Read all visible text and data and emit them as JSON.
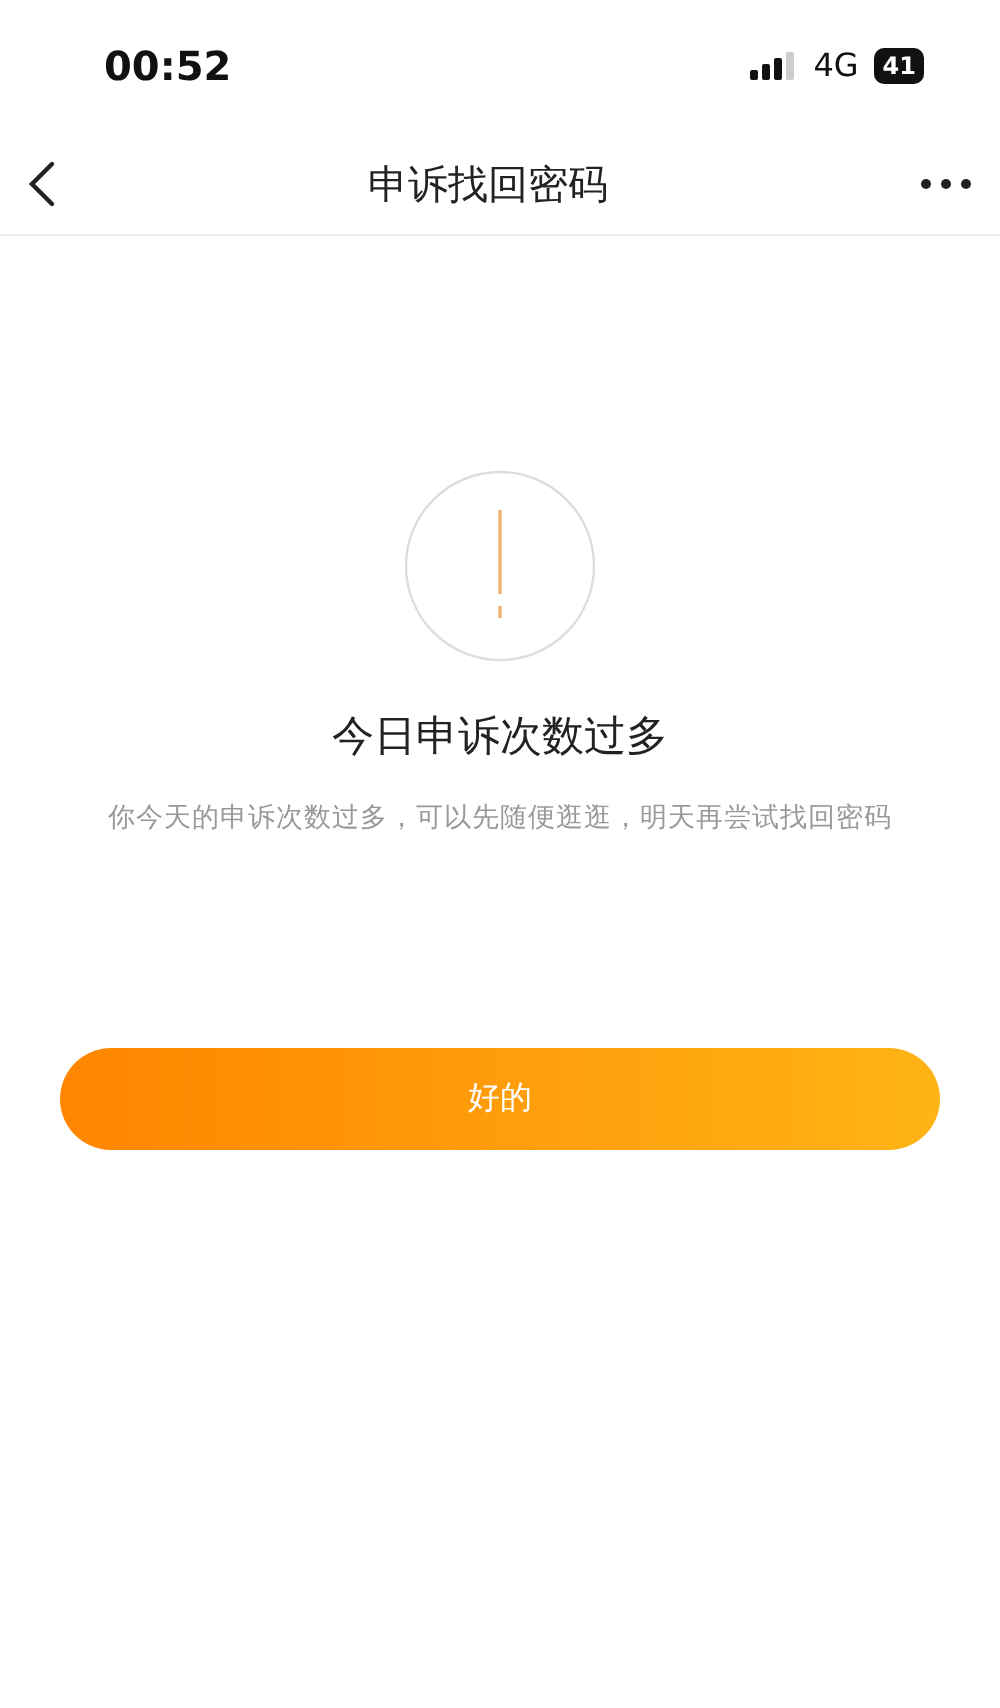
{
  "status_bar": {
    "time": "00:52",
    "network": "4G",
    "battery": "41"
  },
  "nav_bar": {
    "title": "申诉找回密码"
  },
  "message": {
    "heading": "今日申诉次数过多",
    "text": "你今天的申诉次数过多，可以先随便逛逛，明天再尝试找回密码"
  },
  "buttons": [
    {
      "label": "好的"
    }
  ]
}
